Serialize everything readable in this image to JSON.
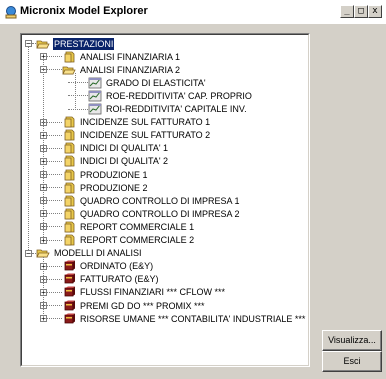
{
  "window": {
    "title": "Micronix Model Explorer",
    "controls": [
      "_",
      "□",
      "x"
    ]
  },
  "tree": {
    "items": [
      {
        "label": "PRESTAZIONI",
        "level": 0,
        "icon": "folder-open-icon",
        "expander": "−",
        "selected": true
      },
      {
        "label": "ANALISI FINANZIARIA 1",
        "level": 1,
        "icon": "folder-closed-icon",
        "expander": "+"
      },
      {
        "label": "ANALISI FINANZIARIA 2",
        "level": 1,
        "icon": "folder-open-icon",
        "expander": "−"
      },
      {
        "label": "GRADO DI ELASTICITA'",
        "level": 2,
        "icon": "report-chart-icon"
      },
      {
        "label": "ROE-REDDITIVITA' CAP. PROPRIO",
        "level": 2,
        "icon": "report-chart-icon"
      },
      {
        "label": "ROI-REDDITIVITA' CAPITALE INV.",
        "level": 2,
        "icon": "report-chart-icon"
      },
      {
        "label": "INCIDENZE SUL FATTURATO 1",
        "level": 1,
        "icon": "folder-closed-icon",
        "expander": "+"
      },
      {
        "label": "INCIDENZE SUL FATTURATO 2",
        "level": 1,
        "icon": "folder-closed-icon",
        "expander": "+"
      },
      {
        "label": "INDICI DI QUALITA' 1",
        "level": 1,
        "icon": "folder-closed-icon",
        "expander": "+"
      },
      {
        "label": "INDICI DI QUALITA' 2",
        "level": 1,
        "icon": "folder-closed-icon",
        "expander": "+"
      },
      {
        "label": "PRODUZIONE 1",
        "level": 1,
        "icon": "folder-closed-icon",
        "expander": "+"
      },
      {
        "label": "PRODUZIONE 2",
        "level": 1,
        "icon": "folder-closed-icon",
        "expander": "+"
      },
      {
        "label": "QUADRO CONTROLLO DI IMPRESA 1",
        "level": 1,
        "icon": "folder-closed-icon",
        "expander": "+"
      },
      {
        "label": "QUADRO CONTROLLO DI IMPRESA 2",
        "level": 1,
        "icon": "folder-closed-icon",
        "expander": "+"
      },
      {
        "label": "REPORT COMMERCIALE 1",
        "level": 1,
        "icon": "folder-closed-icon",
        "expander": "+"
      },
      {
        "label": "REPORT COMMERCIALE 2",
        "level": 1,
        "icon": "folder-closed-icon",
        "expander": "+"
      },
      {
        "label": "MODELLI DI ANALISI",
        "level": 0,
        "icon": "folder-open-icon",
        "expander": "−"
      },
      {
        "label": "ORDINATO (E&Y)",
        "level": 1,
        "icon": "cube-model-icon",
        "expander": "+"
      },
      {
        "label": "FATTURATO (E&Y)",
        "level": 1,
        "icon": "cube-model-icon",
        "expander": "+"
      },
      {
        "label": "FLUSSI FINANZIARI *** CFLOW ***",
        "level": 1,
        "icon": "cube-model-icon",
        "expander": "+"
      },
      {
        "label": "PREMI GD DO *** PROMIX ***",
        "level": 1,
        "icon": "cube-model-icon",
        "expander": "+"
      },
      {
        "label": "RISORSE UMANE *** CONTABILITA' INDUSTRIALE ***",
        "level": 1,
        "icon": "cube-model-icon",
        "expander": "+"
      }
    ]
  },
  "buttons": {
    "view": "Visualizza...",
    "exit": "Esci"
  },
  "colors": {
    "selection": "#0a246a",
    "window_face": "#d4d0c8",
    "folder": "#e8c84a",
    "cube": "#8a1a1a"
  }
}
